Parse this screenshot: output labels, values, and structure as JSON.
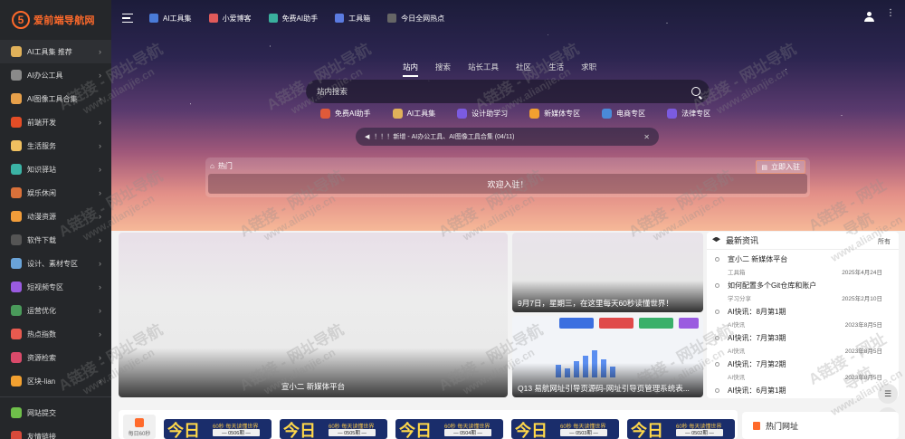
{
  "brand": {
    "logo_text": "爱前端导航网",
    "logo_glyph": "5"
  },
  "sidebar": {
    "items": [
      {
        "label": "AI工具集 推荐",
        "icon": "robot-icon",
        "color": "#e0b15a"
      },
      {
        "label": "AI办公工具",
        "icon": "office-icon",
        "color": "#8a8a8a"
      },
      {
        "label": "AI图像工具合集",
        "icon": "image-icon",
        "color": "#e7a04a"
      },
      {
        "label": "前端开发",
        "icon": "html5-icon",
        "color": "#e44d26"
      },
      {
        "label": "生活服务",
        "icon": "ice-cream-icon",
        "color": "#f0c060"
      },
      {
        "label": "知识驿站",
        "icon": "books-icon",
        "color": "#3bb3a5"
      },
      {
        "label": "娱乐休闲",
        "icon": "basket-icon",
        "color": "#d9713a"
      },
      {
        "label": "动漫资源",
        "icon": "anime-icon",
        "color": "#f29d3a"
      },
      {
        "label": "软件下载",
        "icon": "download-icon",
        "color": "#555555"
      },
      {
        "label": "设计、素材专区",
        "icon": "tools-icon",
        "color": "#6aa3d8"
      },
      {
        "label": "短视频专区",
        "icon": "video-icon",
        "color": "#9a5be0"
      },
      {
        "label": "运营优化",
        "icon": "chart-icon",
        "color": "#4a9a5b"
      },
      {
        "label": "热点指数",
        "icon": "fire-icon",
        "color": "#e85a4f"
      },
      {
        "label": "资源检索",
        "icon": "eye-icon",
        "color": "#d94a6a"
      },
      {
        "label": "区块-lian",
        "icon": "bitcoin-icon",
        "color": "#f2a030"
      }
    ],
    "footer_items": [
      {
        "label": "网站提交",
        "icon": "submit-icon",
        "color": "#6fbf4a"
      },
      {
        "label": "友情链接",
        "icon": "link-icon",
        "color": "#d94a3a"
      }
    ],
    "arrow_glyph": "›"
  },
  "topnav": {
    "links": [
      {
        "label": "AI工具集",
        "icon": "ai-tools-icon",
        "color": "#4a7bd8"
      },
      {
        "label": "小爱博客",
        "icon": "blog-icon",
        "color": "#e05a5a"
      },
      {
        "label": "免费AI助手",
        "icon": "assistant-icon",
        "color": "#3ab09e"
      },
      {
        "label": "工具箱",
        "icon": "toolbox-icon",
        "color": "#5b7be0"
      },
      {
        "label": "今日全网热点",
        "icon": "hot-icon",
        "color": "#666666"
      }
    ],
    "dots_glyph": "·\n·\n·"
  },
  "search": {
    "tabs": [
      "站内",
      "搜索",
      "站长工具",
      "社区",
      "生活",
      "求职"
    ],
    "active_tab": 0,
    "placeholder": "站内搜索",
    "quick_links": [
      {
        "label": "免费AI助手",
        "icon": "assistant-icon",
        "color": "#e05a3a"
      },
      {
        "label": "AI工具集",
        "icon": "robot-icon",
        "color": "#e0b15a"
      },
      {
        "label": "设计助学习",
        "icon": "star-icon",
        "color": "#7b5be0"
      },
      {
        "label": "新媒体专区",
        "icon": "media-icon",
        "color": "#f2a030"
      },
      {
        "label": "电商专区",
        "icon": "card-icon",
        "color": "#4a8ad8"
      },
      {
        "label": "法律专区",
        "icon": "search-icon",
        "color": "#7b5be0"
      }
    ]
  },
  "notice": {
    "text": "！！！新增 - AI办公工具、AI图像工具合集 (04/11)",
    "speaker_glyph": "◀",
    "close_glyph": "✕"
  },
  "hot": {
    "title": "热门",
    "join_label": "立即入驻",
    "banner_text": "欢迎入驻！",
    "home_glyph": "⌂",
    "join_glyph": "▤"
  },
  "cards": {
    "main_caption": "宣小二 新媒体平台",
    "top_caption": "9月7日，星期三，在这里每天60秒读懂世界！",
    "bottom_caption": "Q13 易航网址引导页源码-网址引导页管理系统表..."
  },
  "news": {
    "title": "最新资讯",
    "all_label": "所有",
    "items": [
      {
        "title": "宣小二 新媒体平台",
        "category": "工具箱",
        "date": "2025年4月24日"
      },
      {
        "title": "如何配置多个Git仓库和账户",
        "category": "学习分享",
        "date": "2025年2月10日"
      },
      {
        "title": "AI快讯：8月第1期",
        "category": "AI快讯",
        "date": "2023年8月5日"
      },
      {
        "title": "AI快讯：7月第3期",
        "category": "AI快讯",
        "date": "2023年8月5日"
      },
      {
        "title": "AI快讯：7月第2期",
        "category": "AI快讯",
        "date": "2023年8月5日"
      },
      {
        "title": "AI快讯：6月第1期",
        "category": "",
        "date": ""
      }
    ]
  },
  "float_buttons": [
    {
      "icon": "list-icon",
      "glyph": "☰"
    },
    {
      "icon": "moon-icon",
      "glyph": "☾"
    }
  ],
  "bottom": {
    "calendar_label": "每日60秒",
    "thumbs": [
      {
        "big": "今日",
        "small": "60秒 每天读懂世界",
        "label": "— 0506期 —"
      },
      {
        "big": "今日",
        "small": "60秒 每天读懂世界",
        "label": "— 0505期 —"
      },
      {
        "big": "今日",
        "small": "60秒 每天读懂世界",
        "label": "— 0504期 —"
      },
      {
        "big": "今日",
        "small": "60秒 每天读懂世界",
        "label": "— 0503期 —"
      },
      {
        "big": "今日",
        "small": "60秒 每天读懂世界",
        "label": "— 0502期 —"
      }
    ],
    "hot_sites_title": "热门网址"
  },
  "watermark": {
    "line1": "A链接 - 网址导航",
    "line2": "www.alianjie.cn"
  },
  "colors": {
    "accent": "#ff6a2b",
    "sidebar_bg": "#25272a"
  }
}
